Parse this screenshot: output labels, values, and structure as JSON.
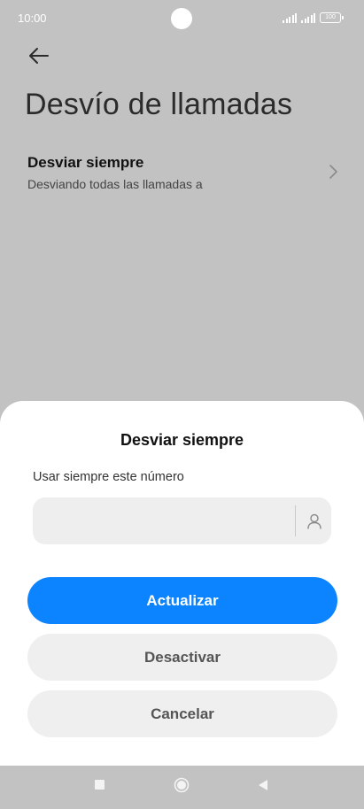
{
  "status_bar": {
    "time": "10:00",
    "battery": "100"
  },
  "header": {
    "title": "Desvío de llamadas"
  },
  "setting": {
    "title": "Desviar siempre",
    "subtitle": "Desviando todas las llamadas a"
  },
  "dialog": {
    "title": "Desviar siempre",
    "field_label": "Usar siempre este número",
    "number_value": "",
    "buttons": {
      "update": "Actualizar",
      "disable": "Desactivar",
      "cancel": "Cancelar"
    }
  },
  "colors": {
    "accent": "#0d84ff",
    "overlay": "#c2c2c2",
    "secondary_button": "#efefef"
  },
  "icons": {
    "back": "arrow-left-icon",
    "chevron": "chevron-right-icon",
    "contact": "person-icon",
    "nav_recents": "square-icon",
    "nav_home": "circle-icon",
    "nav_back": "triangle-back-icon"
  }
}
